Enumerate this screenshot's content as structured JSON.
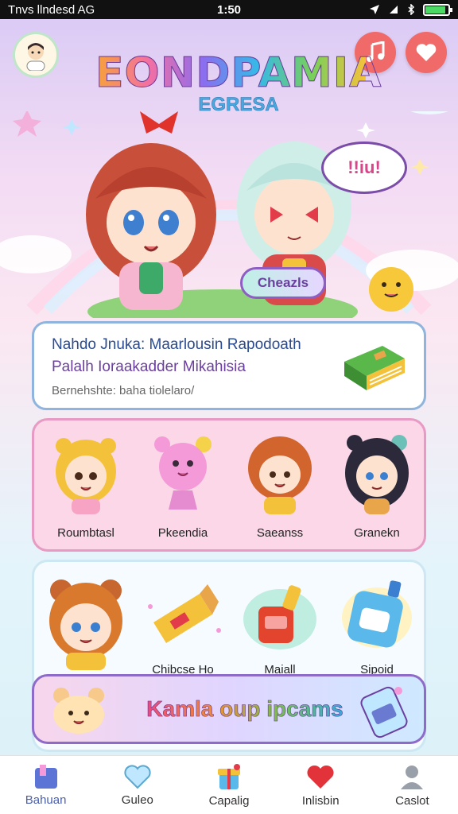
{
  "status_bar": {
    "carrier": "Tnvs llndesd AG",
    "time": "1:50",
    "battery_level": 0.9
  },
  "header": {
    "title": "EONDPAMIA",
    "subtitle": "EGRESA",
    "music_icon": "music-note-icon",
    "heart_icon": "heart-icon"
  },
  "hero": {
    "speech_bubble": "!!iu!",
    "badge": "Cheazls"
  },
  "info_card": {
    "line1": "Nahdo Jnuka: Maarlousin Rapodoath",
    "line2": "Palalh Ioraakadder Mikahisia",
    "line3": "Bernehshte: baha tiolelaro/"
  },
  "characters": [
    {
      "label": "Roumbtasl"
    },
    {
      "label": "Pkeendia"
    },
    {
      "label": "Saeanss"
    },
    {
      "label": "Granekn"
    }
  ],
  "items": [
    {
      "label": ""
    },
    {
      "label": "Chibcse Ho"
    },
    {
      "label": "Maiall"
    },
    {
      "label": "Sipoid"
    }
  ],
  "banner": {
    "text": "Kamla oup ipcams"
  },
  "tabs": [
    {
      "label": "Bahuan",
      "icon": "home-icon",
      "active": true
    },
    {
      "label": "Guleo",
      "icon": "heart-outline-icon",
      "active": false
    },
    {
      "label": "Capalig",
      "icon": "gift-box-icon",
      "active": false
    },
    {
      "label": "Inlisbin",
      "icon": "heart-icon",
      "active": false
    },
    {
      "label": "Caslot",
      "icon": "profile-icon",
      "active": false
    }
  ],
  "colors": {
    "accent": "#f06a6a",
    "primary": "#6b3fa0",
    "card_pink": "#fbd7e8"
  }
}
